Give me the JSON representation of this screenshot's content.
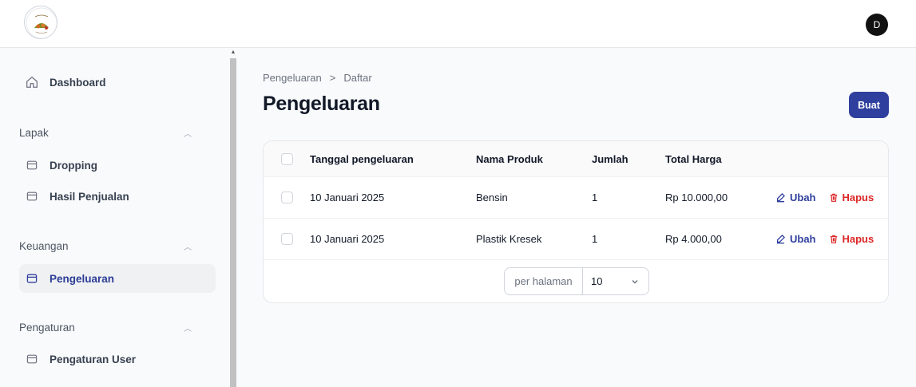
{
  "topbar": {
    "avatar_initial": "D"
  },
  "sidebar": {
    "dashboard": "Dashboard",
    "groups": [
      {
        "label": "Lapak",
        "items": [
          "Dropping",
          "Hasil Penjualan"
        ]
      },
      {
        "label": "Keuangan",
        "items": [
          "Pengeluaran"
        ]
      },
      {
        "label": "Pengaturan",
        "items": [
          "Pengaturan User"
        ]
      }
    ],
    "active_item": "Pengeluaran"
  },
  "breadcrumb": {
    "parent": "Pengeluaran",
    "separator": ">",
    "current": "Daftar"
  },
  "page": {
    "title": "Pengeluaran",
    "create_label": "Buat"
  },
  "table": {
    "columns": [
      "Tanggal pengeluaran",
      "Nama Produk",
      "Jumlah",
      "Total Harga"
    ],
    "rows": [
      {
        "date": "10 Januari 2025",
        "product": "Bensin",
        "qty": "1",
        "total": "Rp 10.000,00"
      },
      {
        "date": "10 Januari 2025",
        "product": "Plastik Kresek",
        "qty": "1",
        "total": "Rp 4.000,00"
      }
    ],
    "actions": {
      "edit": "Ubah",
      "delete": "Hapus"
    }
  },
  "pagination": {
    "label": "per halaman",
    "value": "10"
  },
  "colors": {
    "primary": "#2f3f9e",
    "danger": "#dc2626"
  }
}
